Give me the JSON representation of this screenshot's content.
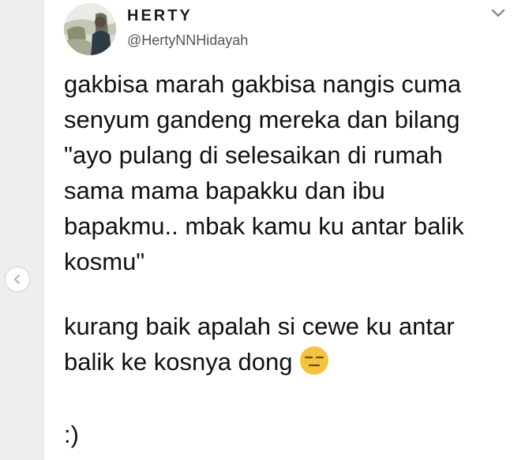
{
  "author": {
    "display_name": "HERTY",
    "handle": "@HertyNNHidayah"
  },
  "tweet": {
    "paragraph1": "gakbisa marah gakbisa nangis cuma\nsenyum gandeng mereka dan bilang\n\"ayo pulang di selesaikan di rumah\nsama mama bapakku dan ibu\nbapakmu.. mbak kamu ku antar balik\nkosmu\"",
    "paragraph2": "kurang baik apalah si cewe ku antar\nbalik ke kosnya dong",
    "paragraph3": ":)",
    "emoji": "expressionless-face-emoji"
  },
  "icons": {
    "menu": "chevron-down-icon",
    "prev": "chevron-left-icon"
  },
  "colors": {
    "emoji_yellow": "#f5c33b",
    "text": "#111111",
    "handle": "#555555"
  }
}
